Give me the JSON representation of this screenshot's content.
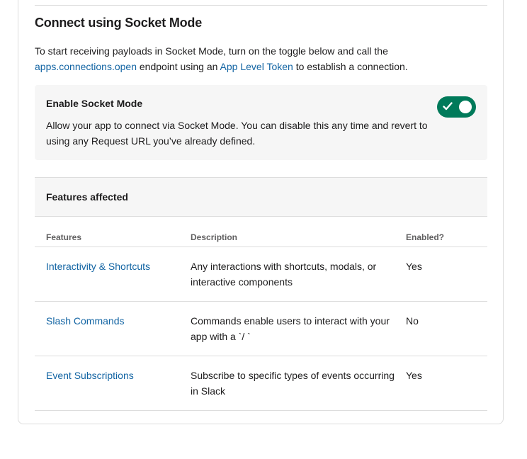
{
  "section": {
    "title": "Connect using Socket Mode",
    "intro_prefix": "To start receiving payloads in Socket Mode, turn on the toggle below and call the",
    "intro_link1": "apps.connections.open",
    "intro_mid": " endpoint using an ",
    "intro_link2": "App Level Token",
    "intro_suffix": " to establish a connection."
  },
  "socket_mode": {
    "label": "Enable Socket Mode",
    "description": "Allow your app to connect via Socket Mode. You can disable this any time and revert to using any Request URL you’ve already defined.",
    "enabled": true,
    "toggle_color": "#007a5a"
  },
  "features": {
    "title": "Features affected",
    "columns": [
      "Features",
      "Description",
      "Enabled?"
    ],
    "rows": [
      {
        "name": "Interactivity & Shortcuts",
        "description": "Any interactions with shortcuts, modals, or interactive components",
        "enabled": "Yes"
      },
      {
        "name": "Slash Commands",
        "description": "Commands enable users to interact with your app with a `/ `",
        "enabled": "No"
      },
      {
        "name": "Event Subscriptions",
        "description": "Subscribe to specific types of events occurring in Slack",
        "enabled": "Yes"
      }
    ]
  },
  "colors": {
    "link": "#1264a3",
    "panel_bg": "#f6f6f6",
    "border": "#dddddd"
  }
}
